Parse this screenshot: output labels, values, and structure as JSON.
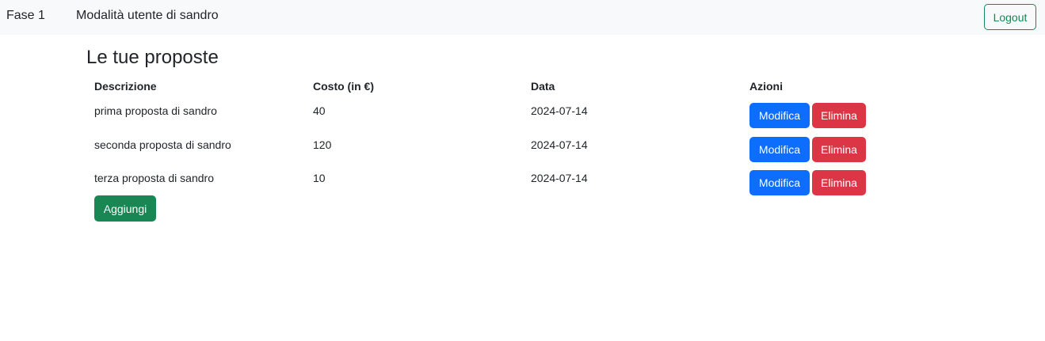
{
  "navbar": {
    "brand": "Fase 1",
    "mode": "Modalità utente di sandro",
    "logout_label": "Logout"
  },
  "main": {
    "title": "Le tue proposte",
    "table": {
      "headers": [
        "Descrizione",
        "Costo (in €)",
        "Data",
        "Azioni"
      ],
      "rows": [
        {
          "descrizione": "prima proposta di sandro",
          "costo": "40",
          "data": "2024-07-14"
        },
        {
          "descrizione": "seconda proposta di sandro",
          "costo": "120",
          "data": "2024-07-14"
        },
        {
          "descrizione": "terza proposta di sandro",
          "costo": "10",
          "data": "2024-07-14"
        }
      ],
      "edit_label": "Modifica",
      "delete_label": "Elimina"
    },
    "add_label": "Aggiungi"
  },
  "colors": {
    "primary": "#0d6efd",
    "danger": "#dc3545",
    "success": "#198754",
    "navbar_bg": "#f8f9fa"
  }
}
